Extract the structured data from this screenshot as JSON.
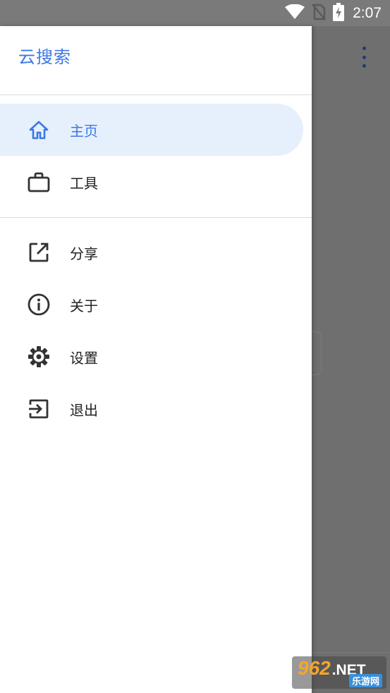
{
  "status_bar": {
    "time": "2:07",
    "icons": [
      "wifi-icon",
      "no-sim-icon",
      "battery-charging-icon"
    ]
  },
  "drawer": {
    "title": "云搜索",
    "primary_items": [
      {
        "label": "主页",
        "icon": "home-icon",
        "active": true
      },
      {
        "label": "工具",
        "icon": "briefcase-icon",
        "active": false
      }
    ],
    "secondary_items": [
      {
        "label": "分享",
        "icon": "open-in-new-icon"
      },
      {
        "label": "关于",
        "icon": "info-icon"
      },
      {
        "label": "设置",
        "icon": "gear-icon"
      },
      {
        "label": "退出",
        "icon": "exit-icon"
      }
    ]
  },
  "background": {
    "menu_icon": "more-vert-icon"
  },
  "watermark": {
    "number": "962",
    "suffix": ".NET",
    "caption": "乐游网"
  },
  "colors": {
    "accent": "#3b78e7",
    "active_bg": "#e6effc",
    "scrim": "#6f6f6f"
  }
}
